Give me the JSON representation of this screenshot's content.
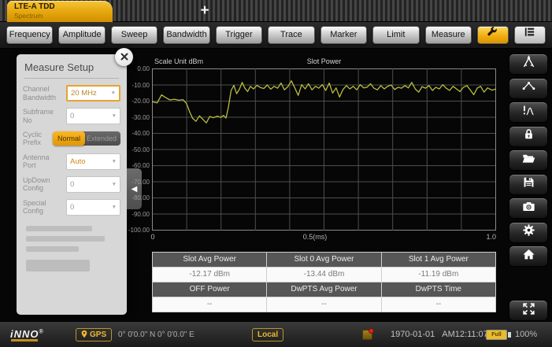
{
  "window": {
    "tab_title": "LTE-A TDD",
    "tab_subtitle": "Spectrum",
    "new_tab_label": "+"
  },
  "toolbar": {
    "buttons": [
      "Frequency",
      "Amplitude",
      "Sweep",
      "Bandwidth",
      "Trigger",
      "Trace",
      "Marker",
      "Limit",
      "Measure"
    ],
    "icons": [
      "wrench-icon",
      "menu-list-icon"
    ]
  },
  "measure_setup": {
    "title": "Measure Setup",
    "close_icon": "close-icon",
    "fields": [
      {
        "label": "Channel Bandwidth",
        "type": "dropdown",
        "value": "20 MHz",
        "highlighted": true
      },
      {
        "label": "Subframe No",
        "type": "dropdown",
        "value": "0"
      },
      {
        "label": "Cyclic Prefix",
        "type": "toggle",
        "options": [
          "Normal",
          "Extended"
        ],
        "selected": "Normal"
      },
      {
        "label": "Antenna Port",
        "type": "dropdown",
        "value": "Auto",
        "accent": true
      },
      {
        "label": "UpDown Config",
        "type": "dropdown",
        "value": "0"
      },
      {
        "label": "Special Config",
        "type": "dropdown",
        "value": "0"
      }
    ]
  },
  "chart_data": {
    "type": "line",
    "title": "Slot Power",
    "scale_unit_label": "Scale Unit dBm",
    "ylabel": "dBm",
    "ylim": [
      -100,
      0
    ],
    "y_ticks": [
      "0.00",
      "-10.00",
      "-20.00",
      "-30.00",
      "-40.00",
      "-50.00",
      "-60.00",
      "-70.00",
      "-80.00",
      "-90.00",
      "-100.00"
    ],
    "x_range": [
      0,
      1
    ],
    "x_ticks": [
      "0",
      "0.5(ms)",
      "1.0"
    ],
    "x_divisions": 10,
    "grid": true,
    "trace_color": "#b9bd3c",
    "series": [
      {
        "name": "Slot Power",
        "points": [
          [
            0.0,
            -20.5
          ],
          [
            0.015,
            -21.2
          ],
          [
            0.028,
            -16.3
          ],
          [
            0.04,
            -18.0
          ],
          [
            0.052,
            -19.4
          ],
          [
            0.065,
            -19.0
          ],
          [
            0.078,
            -19.6
          ],
          [
            0.09,
            -19.2
          ],
          [
            0.1,
            -21.5
          ],
          [
            0.11,
            -27.0
          ],
          [
            0.118,
            -30.8
          ],
          [
            0.128,
            -32.6
          ],
          [
            0.138,
            -29.2
          ],
          [
            0.148,
            -31.4
          ],
          [
            0.158,
            -33.6
          ],
          [
            0.168,
            -29.6
          ],
          [
            0.178,
            -30.4
          ],
          [
            0.19,
            -29.4
          ],
          [
            0.2,
            -30.2
          ],
          [
            0.208,
            -29.0
          ],
          [
            0.215,
            -30.6
          ],
          [
            0.222,
            -24.0
          ],
          [
            0.23,
            -13.6
          ],
          [
            0.238,
            -10.4
          ],
          [
            0.246,
            -15.6
          ],
          [
            0.254,
            -12.8
          ],
          [
            0.262,
            -8.6
          ],
          [
            0.27,
            -12.2
          ],
          [
            0.278,
            -14.2
          ],
          [
            0.286,
            -11.0
          ],
          [
            0.295,
            -12.6
          ],
          [
            0.305,
            -10.4
          ],
          [
            0.315,
            -11.8
          ],
          [
            0.325,
            -12.4
          ],
          [
            0.335,
            -10.2
          ],
          [
            0.345,
            -12.8
          ],
          [
            0.355,
            -11.0
          ],
          [
            0.365,
            -12.2
          ],
          [
            0.375,
            -9.0
          ],
          [
            0.385,
            -13.2
          ],
          [
            0.395,
            -11.2
          ],
          [
            0.405,
            -7.6
          ],
          [
            0.415,
            -12.0
          ],
          [
            0.425,
            -16.6
          ],
          [
            0.435,
            -10.0
          ],
          [
            0.445,
            -12.6
          ],
          [
            0.455,
            -9.4
          ],
          [
            0.465,
            -13.2
          ],
          [
            0.475,
            -11.0
          ],
          [
            0.485,
            -12.2
          ],
          [
            0.495,
            -10.0
          ],
          [
            0.505,
            -13.6
          ],
          [
            0.515,
            -9.0
          ],
          [
            0.525,
            -15.2
          ],
          [
            0.535,
            -12.0
          ],
          [
            0.545,
            -17.6
          ],
          [
            0.555,
            -13.0
          ],
          [
            0.565,
            -10.6
          ],
          [
            0.575,
            -12.6
          ],
          [
            0.585,
            -11.0
          ],
          [
            0.595,
            -13.2
          ],
          [
            0.605,
            -10.0
          ],
          [
            0.615,
            -12.0
          ],
          [
            0.625,
            -11.6
          ],
          [
            0.635,
            -9.4
          ],
          [
            0.645,
            -12.2
          ],
          [
            0.655,
            -13.2
          ],
          [
            0.665,
            -10.6
          ],
          [
            0.675,
            -12.6
          ],
          [
            0.685,
            -11.0
          ],
          [
            0.695,
            -10.2
          ],
          [
            0.705,
            -13.0
          ],
          [
            0.715,
            -11.6
          ],
          [
            0.725,
            -12.2
          ],
          [
            0.735,
            -10.6
          ],
          [
            0.745,
            -12.0
          ],
          [
            0.755,
            -8.6
          ],
          [
            0.765,
            -12.6
          ],
          [
            0.775,
            -14.6
          ],
          [
            0.785,
            -11.2
          ],
          [
            0.795,
            -12.2
          ],
          [
            0.805,
            -10.6
          ],
          [
            0.815,
            -13.6
          ],
          [
            0.825,
            -11.6
          ],
          [
            0.835,
            -12.6
          ],
          [
            0.845,
            -10.0
          ],
          [
            0.855,
            -12.2
          ],
          [
            0.865,
            -13.6
          ],
          [
            0.875,
            -11.0
          ],
          [
            0.885,
            -12.6
          ],
          [
            0.895,
            -14.2
          ],
          [
            0.905,
            -11.6
          ],
          [
            0.915,
            -10.6
          ],
          [
            0.925,
            -13.2
          ],
          [
            0.935,
            -16.2
          ],
          [
            0.945,
            -12.2
          ],
          [
            0.955,
            -11.0
          ],
          [
            0.965,
            -14.6
          ],
          [
            0.975,
            -12.0
          ],
          [
            0.988,
            -13.4
          ],
          [
            1.0,
            -12.6
          ]
        ]
      }
    ]
  },
  "results_table": {
    "rows": [
      {
        "style": "header",
        "cells": [
          "Slot Avg Power",
          "Slot 0 Avg Power",
          "Slot 1 Avg Power"
        ]
      },
      {
        "style": "value",
        "cells": [
          "-12.17 dBm",
          "-13.44 dBm",
          "-11.19 dBm"
        ]
      },
      {
        "style": "header",
        "cells": [
          "OFF Power",
          "DwPTS Avg Power",
          "DwPTS Time"
        ]
      },
      {
        "style": "value",
        "cells": [
          "--",
          "--",
          "--"
        ]
      }
    ]
  },
  "side_toolbar": {
    "icons": [
      "compass-tool-icon",
      "trace-nodes-icon",
      "limit-peak-icon",
      "lock-icon",
      "folder-open-icon",
      "save-icon",
      "camera-icon",
      "settings-gear-icon",
      "home-icon",
      "fullscreen-icon"
    ]
  },
  "status_bar": {
    "logo": "iNNO",
    "registered_mark": "®",
    "gps_label": "GPS",
    "coordinates": "0° 0'0.0\" N 0° 0'0.0\" E",
    "local_label": "Local",
    "date": "1970-01-01",
    "time": "AM12:11:07",
    "battery_label": "Full",
    "battery_percent": "100%"
  },
  "colors": {
    "accent_yellow": "#edb92e",
    "tab_gold": "#e2a20a",
    "trace": "#b9bd3c",
    "panel_gray": "#d7d7d7",
    "toggle_orange": "#f0a512"
  }
}
